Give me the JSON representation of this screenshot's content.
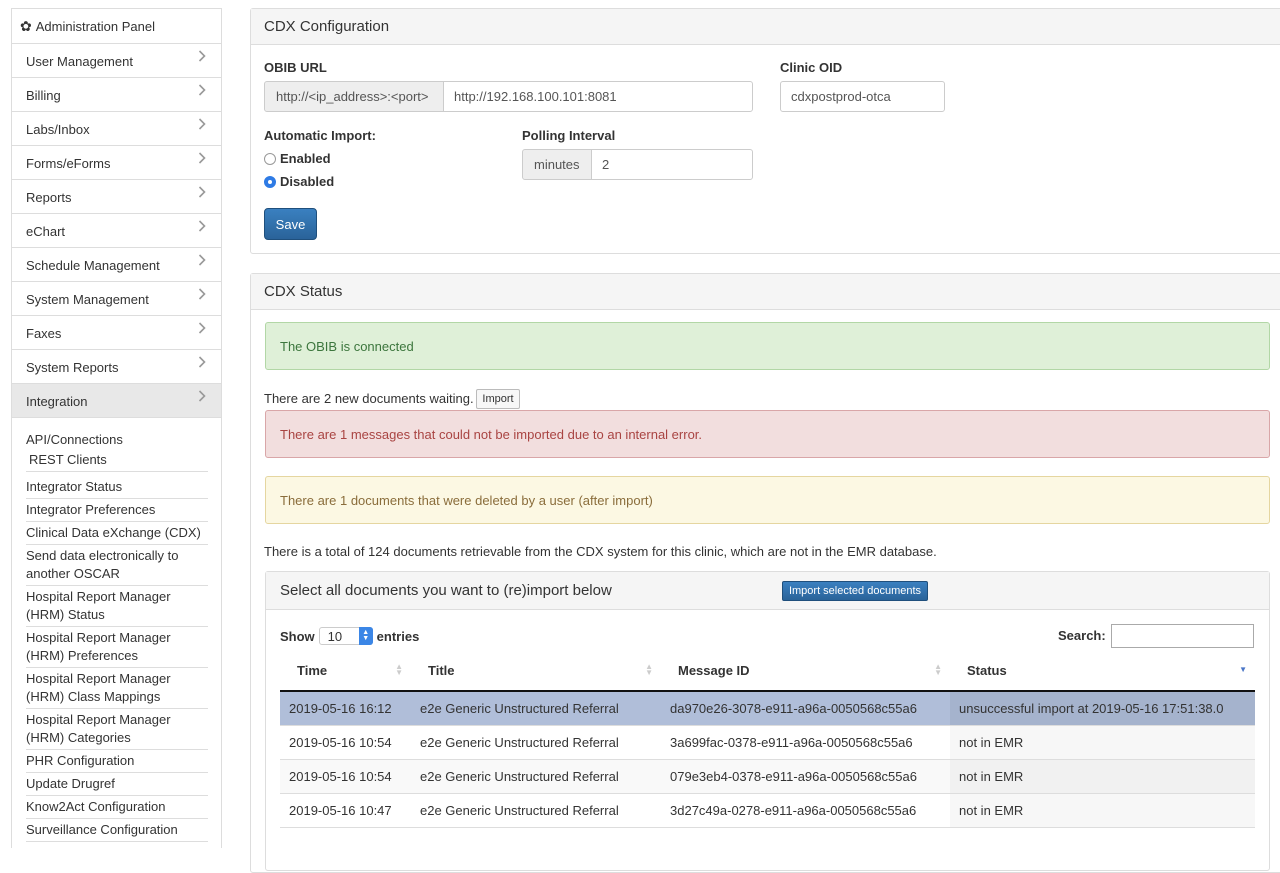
{
  "sidebar": {
    "header": "Administration Panel",
    "items": [
      {
        "label": "User Management"
      },
      {
        "label": "Billing"
      },
      {
        "label": "Labs/Inbox"
      },
      {
        "label": "Forms/eForms"
      },
      {
        "label": "Reports"
      },
      {
        "label": "eChart"
      },
      {
        "label": "Schedule Management"
      },
      {
        "label": "System Management"
      },
      {
        "label": "Faxes"
      },
      {
        "label": "System Reports"
      },
      {
        "label": "Integration"
      }
    ],
    "sub": {
      "api_connections": "API/Connections",
      "rest_clients": "REST Clients",
      "links": [
        "Integrator Status",
        "Integrator Preferences",
        "Clinical Data eXchange (CDX)",
        "Send data electronically to another OSCAR",
        "Hospital Report Manager (HRM) Status",
        "Hospital Report Manager (HRM) Preferences",
        "Hospital Report Manager (HRM) Class Mappings",
        "Hospital Report Manager (HRM) Categories",
        "PHR Configuration",
        "Update Drugref",
        "Know2Act Configuration",
        "Surveillance Configuration"
      ]
    }
  },
  "config": {
    "title": "CDX Configuration",
    "obib_label": "OBIB URL",
    "obib_addon": "http://<ip_address>:<port>",
    "obib_value": "http://192.168.100.101:8081",
    "clinic_label": "Clinic OID",
    "clinic_value": "cdxpostprod-otca",
    "auto_import_label": "Automatic Import:",
    "enabled_label": "Enabled",
    "disabled_label": "Disabled",
    "selected_option": "Disabled",
    "polling_label": "Polling Interval",
    "polling_addon": "minutes",
    "polling_value": "2",
    "save_label": "Save"
  },
  "status": {
    "title": "CDX Status",
    "connected_msg": "The OBIB is connected",
    "waiting_msg": "There are 2 new documents waiting.",
    "import_label": "Import",
    "error_msg": "There are 1 messages that could not be imported due to an internal error.",
    "deleted_msg": "There are 1 documents that were deleted by a user (after import)",
    "total_msg": "There is a total of 124 documents retrievable from the CDX system for this clinic, which are not in the EMR database.",
    "select_title": "Select all documents you want to (re)import below",
    "import_selected_label": "Import selected documents",
    "show_label": "Show",
    "entries_value": "10",
    "entries_label": "entries",
    "search_label": "Search:",
    "search_value": "",
    "columns": [
      "Time",
      "Title",
      "Message ID",
      "Status"
    ],
    "rows": [
      {
        "time": "2019-05-16 16:12",
        "title": "e2e Generic Unstructured Referral",
        "message_id": "da970e26-3078-e911-a96a-0050568c55a6",
        "status": "unsuccessful import at 2019-05-16 17:51:38.0"
      },
      {
        "time": "2019-05-16 10:54",
        "title": "e2e Generic Unstructured Referral",
        "message_id": "3a699fac-0378-e911-a96a-0050568c55a6",
        "status": "not in EMR"
      },
      {
        "time": "2019-05-16 10:54",
        "title": "e2e Generic Unstructured Referral",
        "message_id": "079e3eb4-0378-e911-a96a-0050568c55a6",
        "status": "not in EMR"
      },
      {
        "time": "2019-05-16 10:47",
        "title": "e2e Generic Unstructured Referral",
        "message_id": "3d27c49a-0278-e911-a96a-0050568c55a6",
        "status": "not in EMR"
      }
    ]
  },
  "colors": {
    "primary": "#2d6ca2",
    "success_bg": "#dff0d8",
    "danger_bg": "#f2dede",
    "warning_bg": "#fcf8e3",
    "selected_row": "#b0bed9"
  }
}
